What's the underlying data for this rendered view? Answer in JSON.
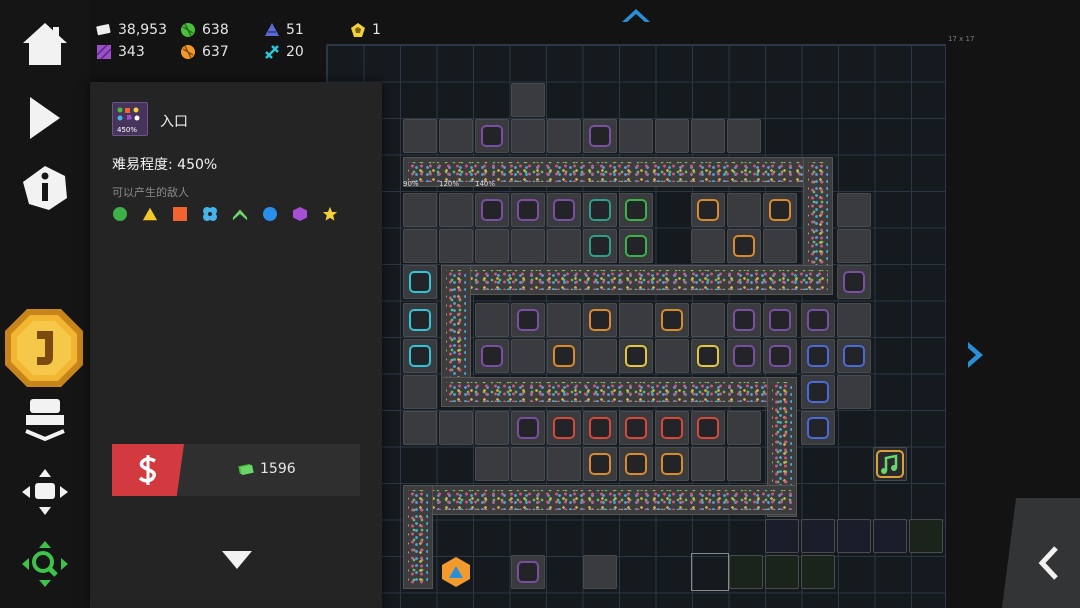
{
  "resources": {
    "money": "38,953",
    "green": "638",
    "blue_triangle": "51",
    "gold_pentagon": "1",
    "purple": "343",
    "orange": "637",
    "cyan": "20"
  },
  "grid_size": "17 x 17",
  "info_panel": {
    "title": "入口",
    "thumb_label": "450%",
    "difficulty": "难易程度: 450%",
    "enemies_label": "可以产生的敌人",
    "enemies": [
      "circle-green",
      "triangle-yellow",
      "square-orange",
      "fan-blue",
      "chevron-green",
      "circle-blue",
      "hexagon-purple",
      "star-yellow"
    ],
    "sell_price": "1596"
  },
  "road_labels": [
    "90%",
    "120%",
    "140%"
  ],
  "colors": {
    "accent_blue": "#2a8fd6",
    "sell_red": "#d23a3f",
    "coin_gold": "#f2b632",
    "green_nav": "#3ec24a"
  }
}
